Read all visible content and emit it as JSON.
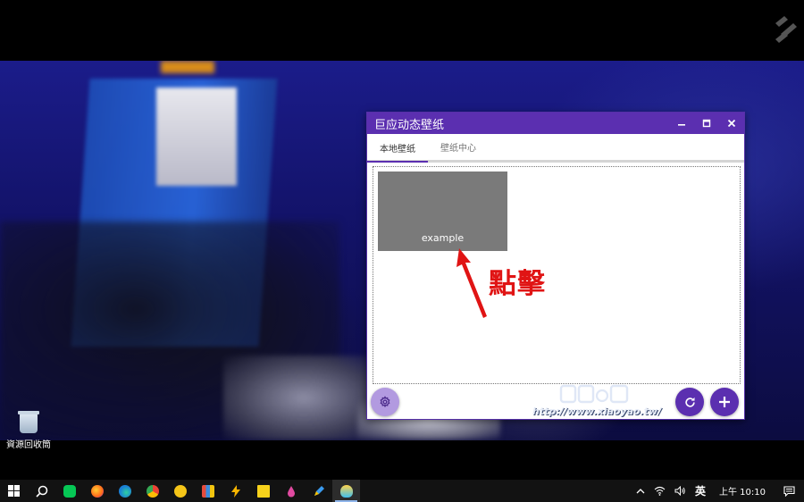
{
  "desktop": {
    "recycle_bin_label": "資源回收筒"
  },
  "app_window": {
    "title": "巨应动态壁纸",
    "controls": [
      "minimize",
      "maximize",
      "close"
    ],
    "tabs": [
      {
        "label": "本地壁纸",
        "active": true
      },
      {
        "label": "壁纸中心",
        "active": false
      }
    ],
    "wallpapers": [
      {
        "label": "example"
      }
    ],
    "buttons": {
      "settings": "gear-icon",
      "refresh": "refresh-icon",
      "add": "plus-icon"
    },
    "accent_color": "#5b2fb0"
  },
  "annotation": {
    "text": "點擊",
    "color": "#e01414"
  },
  "watermark": {
    "url": "http://www.xiaoyao.tw/"
  },
  "taskbar": {
    "apps": [
      "start-icon",
      "search-icon",
      "line-icon",
      "firefox-icon",
      "edge-icon",
      "chrome-icon",
      "emoji-app-icon",
      "office-icon",
      "bolt-app-icon",
      "sticky-notes-icon",
      "drop-app-icon",
      "pen-app-icon",
      "wallpaper-app-icon"
    ],
    "tray": {
      "ime": "英",
      "clock": "上午 10:10"
    }
  }
}
